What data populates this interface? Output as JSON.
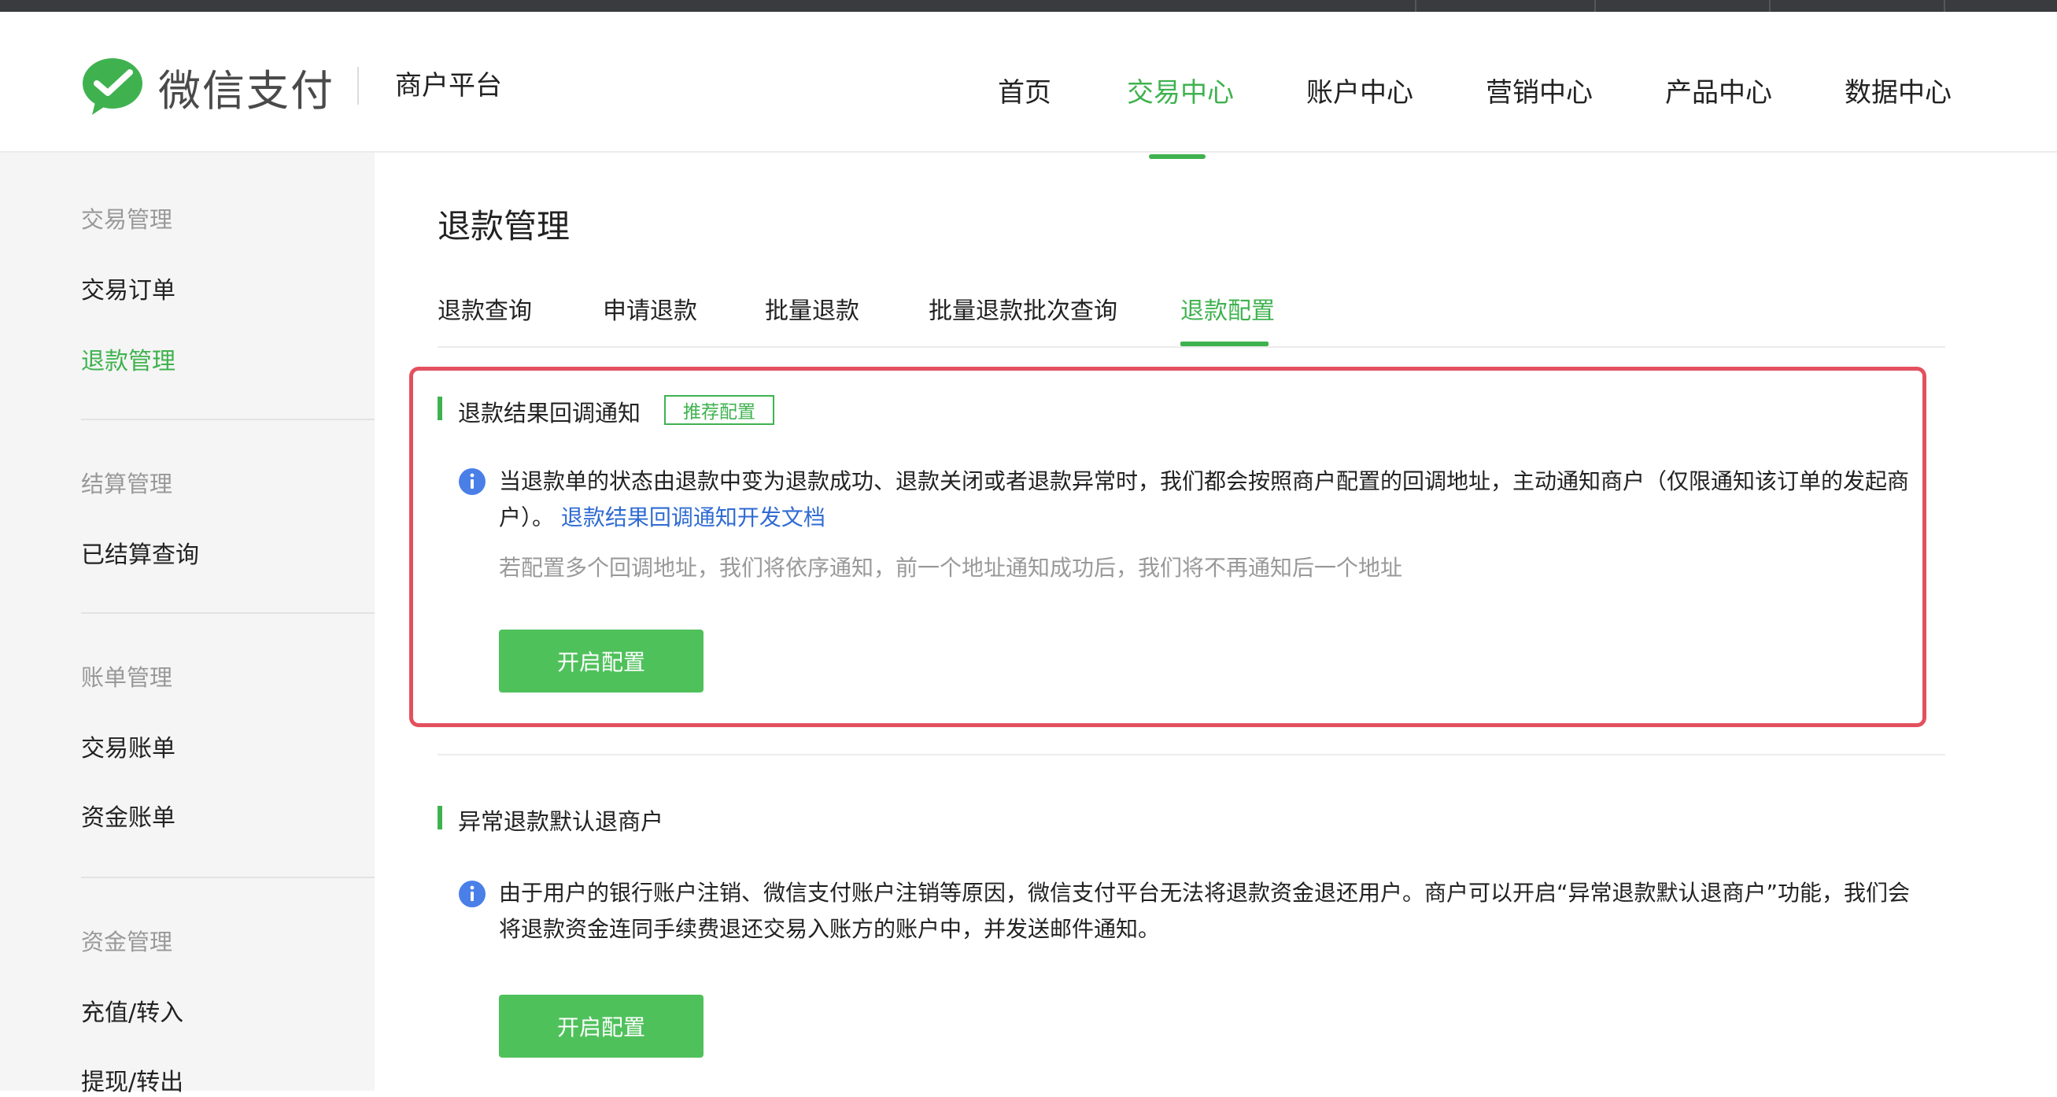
{
  "brand": {
    "logo_text": "微信支付",
    "platform": "商户平台",
    "accent_color": "#3fb24f"
  },
  "nav": {
    "items": [
      {
        "label": "首页"
      },
      {
        "label": "交易中心",
        "active": true
      },
      {
        "label": "账户中心"
      },
      {
        "label": "营销中心"
      },
      {
        "label": "产品中心"
      },
      {
        "label": "数据中心"
      }
    ]
  },
  "sidebar": {
    "groups": [
      {
        "title": "交易管理",
        "items": [
          {
            "label": "交易订单"
          },
          {
            "label": "退款管理",
            "active": true
          }
        ]
      },
      {
        "title": "结算管理",
        "items": [
          {
            "label": "已结算查询"
          }
        ]
      },
      {
        "title": "账单管理",
        "items": [
          {
            "label": "交易账单"
          },
          {
            "label": "资金账单"
          }
        ]
      },
      {
        "title": "资金管理",
        "items": [
          {
            "label": "充值/转入"
          },
          {
            "label": "提现/转出"
          }
        ]
      }
    ]
  },
  "main": {
    "title": "退款管理",
    "tabs": [
      {
        "label": "退款查询"
      },
      {
        "label": "申请退款"
      },
      {
        "label": "批量退款"
      },
      {
        "label": "批量退款批次查询"
      },
      {
        "label": "退款配置",
        "active": true
      }
    ],
    "sections": [
      {
        "title": "退款结果回调通知",
        "tag": "推荐配置",
        "description": "当退款单的状态由退款中变为退款成功、退款关闭或者退款异常时，我们都会按照商户配置的回调地址，主动通知商户（仅限通知该订单的发起商户）。",
        "link_text": "退款结果回调通知开发文档",
        "hint": "若配置多个回调地址，我们将依序通知，前一个地址通知成功后，我们将不再通知后一个地址",
        "button": "开启配置"
      },
      {
        "title": "异常退款默认退商户",
        "description": "由于用户的银行账户注销、微信支付账户注销等原因，微信支付平台无法将退款资金退还用户。商户可以开启“异常退款默认退商户”功能，我们会将退款资金连同手续费退还交易入账方的账户中，并发送邮件通知。",
        "button": "开启配置"
      }
    ]
  }
}
